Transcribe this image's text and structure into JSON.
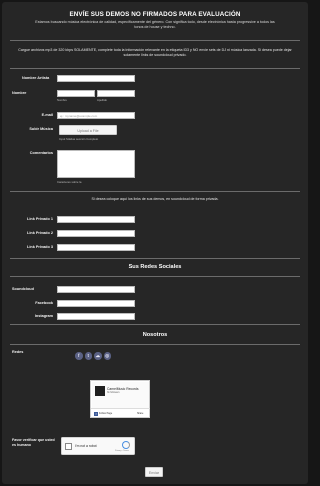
{
  "form": {
    "title": "ENVÍE SUS DEMOS NO FIRMADOS PARA EVALUACIÓN",
    "subtitle": "Estamos buscando música electrónica de calidad, específicamente del género. Con significa todo, desde electrónica hasta progressive a todos las tonos de house y techno.",
    "upload_instructions": "Cargue archivos mp3 de 320 kbps SOLAMENTE, complete toda la información relevante en la etiqueta ID3 y NO envíe sets de DJ ni música lanzada. Si desea puede dejar solamente links de soundcloud privado.",
    "labels": {
      "artist_name": "Nombre Artista",
      "name": "Nombre",
      "first_name_sub": "Nombre",
      "last_name_sub": "Apellido",
      "email": "E-mail",
      "upload_music": "Subir Música",
      "upload_sub": "Input Sólidas sección Completo",
      "comments": "Comentarios",
      "comments_sub": "Caracteres sobre la"
    },
    "email_placeholder": "ej.: myname@example.com",
    "upload_button": "Upload a File",
    "private_links_note": "Si desea coloque aquí los links de sus demos, en soundcloud de forma privada.",
    "private_links": [
      "Link Privado 1",
      "Link Privado 2",
      "Link Privado 3"
    ],
    "social_heading": "Sus Redes Sociales",
    "social_fields": [
      "Soundcloud",
      "Facebook",
      "Instagram"
    ],
    "about_heading": "Nosotros",
    "networks_label": "Redes",
    "network_icons": [
      "facebook-icon",
      "twitter-icon",
      "soundcloud-icon",
      "instagram-icon"
    ],
    "fb_widget": {
      "page_name": "CarnelMusic Records",
      "followers": "3k followers",
      "follow_label": "Follow Page",
      "share_label": "Share"
    },
    "verify_label": "Favor verificar que usted es humano",
    "captcha": {
      "label": "I'm not a robot",
      "privacy": "Privacy - Terms"
    },
    "submit_label": "Enviar"
  },
  "colors": {
    "background": "#262626",
    "page": "#161616",
    "social_icon": "#5a6184"
  }
}
